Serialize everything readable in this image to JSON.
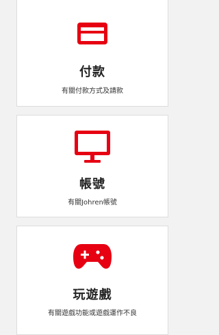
{
  "colors": {
    "accent": "#e60012",
    "background": "#f2f2f2",
    "card": "#ffffff",
    "title_text": "#222222"
  },
  "cards": [
    {
      "icon": "credit-card-icon",
      "title": "付款",
      "description": "有關付款方式及請款"
    },
    {
      "icon": "monitor-icon",
      "title": "帳號",
      "description": "有關Johren帳號"
    },
    {
      "icon": "gamepad-icon",
      "title": "玩遊戲",
      "description": "有關遊戲功能或遊戲運作不良"
    }
  ]
}
